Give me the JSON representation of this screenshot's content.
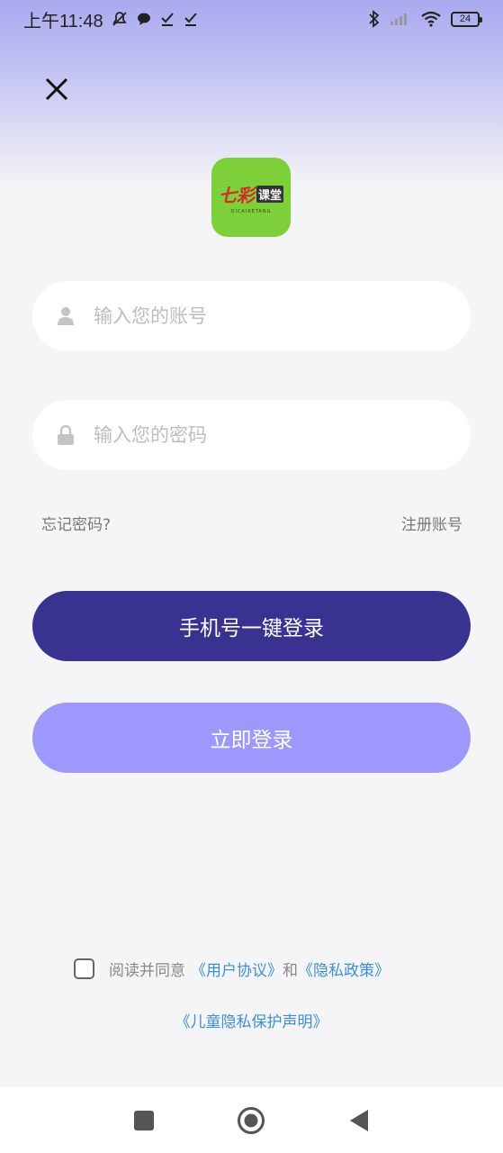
{
  "status_bar": {
    "time_prefix": "上午",
    "time": "11:48",
    "battery": "24",
    "icons_left": [
      "mute-icon",
      "chat-icon",
      "check-icon",
      "check-icon"
    ],
    "icons_right": [
      "bluetooth-icon",
      "signal-icon",
      "wifi-icon",
      "battery-icon"
    ]
  },
  "logo": {
    "brand_red": "七彩",
    "brand_box": "课堂",
    "subtitle": "QICAIKETANG"
  },
  "form": {
    "account_placeholder": "输入您的账号",
    "password_placeholder": "输入您的密码",
    "forgot_password": "忘记密码?",
    "register": "注册账号"
  },
  "buttons": {
    "one_click_login": "手机号一键登录",
    "login_now": "立即登录"
  },
  "agreement": {
    "prefix": "阅读并同意",
    "user_agreement": "《用户协议》",
    "and": "和",
    "privacy_policy": "《隐私政策》",
    "children_privacy": "《儿童隐私保护声明》"
  },
  "colors": {
    "primary": "#3a3290",
    "secondary": "#9d98fb",
    "link": "#3f8fcf",
    "logo_bg": "#7ed03a"
  }
}
